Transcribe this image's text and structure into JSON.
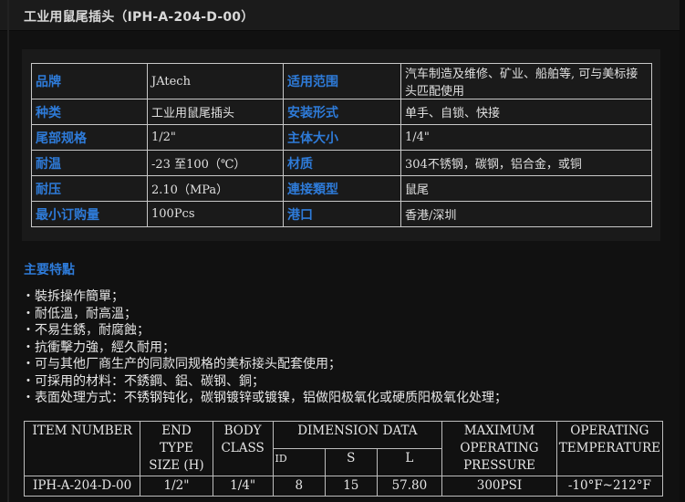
{
  "page": {
    "title": "工业用鼠尾插头（IPH-A-204-D-00）",
    "features_heading": "主要特點",
    "bullet_glyph": "・"
  },
  "spec_rows": [
    {
      "k1": "品牌",
      "v1": "JAtech",
      "k2": "适用范围",
      "v2": "汽车制造及维修、矿业、船舶等, 可与美标接头匹配使用",
      "tall": true
    },
    {
      "k1": "种类",
      "v1": "工业用鼠尾插头",
      "k2": "安装形式",
      "v2": "单手、自锁、快接"
    },
    {
      "k1": "尾部规格",
      "v1": "1/2\"",
      "k2": "主体大小",
      "v2": "1/4\""
    },
    {
      "k1": "耐温",
      "v1": "-23 至100（℃）",
      "k2": "材质",
      "v2": "304不锈钢，碳钢，铝合金，或铜"
    },
    {
      "k1": "耐压",
      "v1": "2.10（MPa）",
      "k2": "連接類型",
      "v2": "鼠尾"
    },
    {
      "k1": "最小订购量",
      "v1": "100Pcs",
      "k2": "港口",
      "v2": "香港/深圳"
    }
  ],
  "features": [
    "裝拆操作簡單；",
    "耐低溫，耐高溫；",
    "不易生銹，耐腐蝕；",
    "抗衝擊力強，經久耐用；",
    "可与其他厂商生产的同款同规格的美标接头配套使用；",
    "可採用的材料：不銹鋼、鋁、碳钢、銅；",
    "表面处理方式：不锈钢钝化，碳钢镀锌或镀镍，铝做阳极氧化或硬质阳极氧化处理；"
  ],
  "dims": {
    "headers": {
      "item": "ITEM NUMBER",
      "end_type": "END\nTYPE\nSIZE (H)",
      "body_class": "BODY\nCLASS",
      "dimension_data": "DIMENSION DATA",
      "id": "ID",
      "s": "S",
      "l": "L",
      "max_pressure": "MAXIMUM\nOPERATING\nPRESSURE",
      "op_temp": "OPERATING\nTEMPERATURE"
    },
    "row": {
      "item": "IPH-A-204-D-00",
      "end_type": "1/2\"",
      "body_class": "1/4\"",
      "id": "8",
      "s": "15",
      "l": "57.80",
      "max_pressure": "300PSI",
      "op_temp": "-10°F~212°F"
    }
  },
  "colors": {
    "background": "#111111",
    "key_text": "#2e7bd9",
    "text": "#e6e6e6",
    "border": "#c8c8c8"
  }
}
